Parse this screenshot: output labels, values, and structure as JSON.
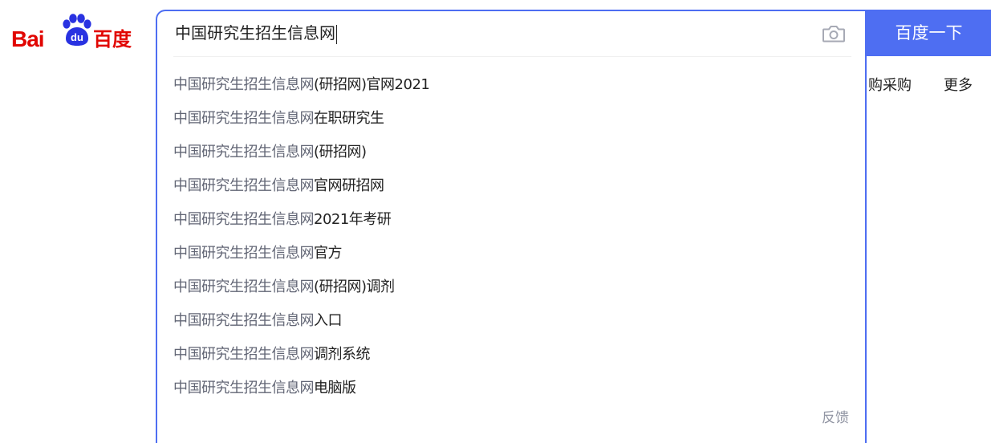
{
  "logo": {
    "latin": "Bai",
    "paw_text": "du",
    "chinese": "百度",
    "brand_color": "#e10602",
    "accent_color": "#4e6ef2"
  },
  "search": {
    "value": "中国研究生招生信息网",
    "camera_icon": "camera-icon",
    "submit_label": "百度一下"
  },
  "suggestions": [
    {
      "match": "中国研究生招生信息网",
      "rest": "(研招网)官网2021"
    },
    {
      "match": "中国研究生招生信息网",
      "rest": "在职研究生"
    },
    {
      "match": "中国研究生招生信息网",
      "rest": "(研招网)"
    },
    {
      "match": "中国研究生招生信息网",
      "rest": "官网研招网"
    },
    {
      "match": "中国研究生招生信息网",
      "rest": "2021年考研"
    },
    {
      "match": "中国研究生招生信息网",
      "rest": "官方"
    },
    {
      "match": "中国研究生招生信息网",
      "rest": "(研招网)调剂"
    },
    {
      "match": "中国研究生招生信息网",
      "rest": "入口"
    },
    {
      "match": "中国研究生招生信息网",
      "rest": "调剂系统"
    },
    {
      "match": "中国研究生招生信息网",
      "rest": "电脑版"
    }
  ],
  "feedback_label": "反馈",
  "nav": {
    "caigou": "购采购",
    "more": "更多"
  }
}
